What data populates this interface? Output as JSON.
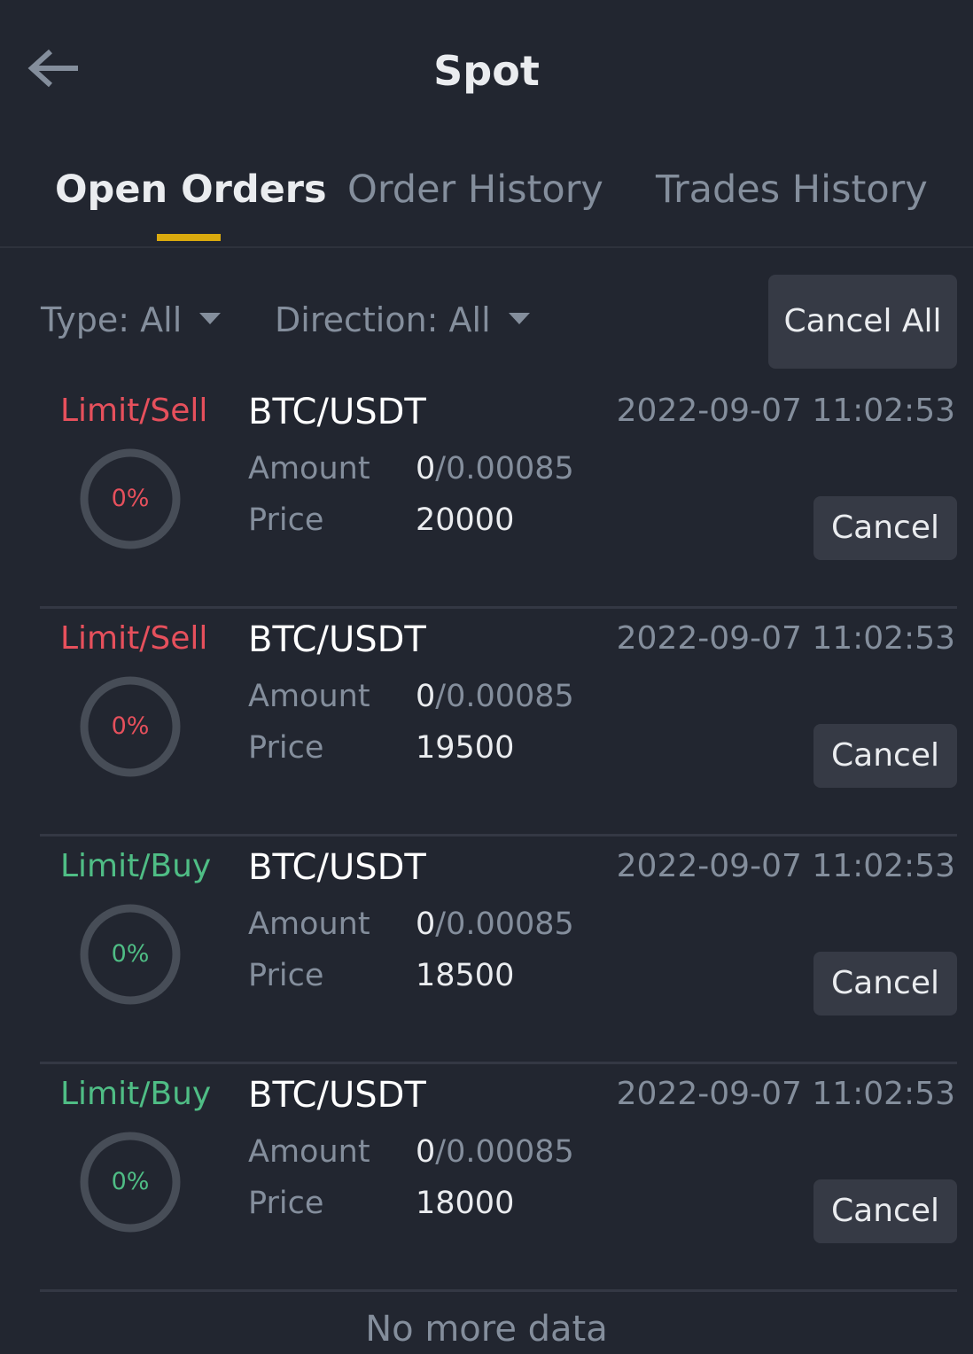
{
  "header": {
    "title": "Spot",
    "back_icon": "arrow-left-icon"
  },
  "tabs": [
    {
      "label": "Open Orders",
      "active": true
    },
    {
      "label": "Order History",
      "active": false
    },
    {
      "label": "Trades History",
      "active": false
    }
  ],
  "filters": {
    "type_label": "Type: All",
    "direction_label": "Direction: All",
    "caret_icon": "caret-down-icon",
    "cancel_all_label": "Cancel All"
  },
  "colors": {
    "background": "#222630",
    "accent": "#F0B90B",
    "sell": "#E6505C",
    "buy": "#4FBD85",
    "muted_text": "#848E9C",
    "button_bg": "#363A45"
  },
  "orders": [
    {
      "side": "Limit/Sell",
      "direction": "sell",
      "pair": "BTC/USDT",
      "time": "2022-09-07 11:02:53",
      "amount_label": "Amount",
      "amount_filled": "0",
      "amount_total": "/0.00085",
      "price_label": "Price",
      "price": "20000",
      "progress_label": "0%",
      "progress": 0,
      "cancel_label": "Cancel"
    },
    {
      "side": "Limit/Sell",
      "direction": "sell",
      "pair": "BTC/USDT",
      "time": "2022-09-07 11:02:53",
      "amount_label": "Amount",
      "amount_filled": "0",
      "amount_total": "/0.00085",
      "price_label": "Price",
      "price": "19500",
      "progress_label": "0%",
      "progress": 0,
      "cancel_label": "Cancel"
    },
    {
      "side": "Limit/Buy",
      "direction": "buy",
      "pair": "BTC/USDT",
      "time": "2022-09-07 11:02:53",
      "amount_label": "Amount",
      "amount_filled": "0",
      "amount_total": "/0.00085",
      "price_label": "Price",
      "price": "18500",
      "progress_label": "0%",
      "progress": 0,
      "cancel_label": "Cancel"
    },
    {
      "side": "Limit/Buy",
      "direction": "buy",
      "pair": "BTC/USDT",
      "time": "2022-09-07 11:02:53",
      "amount_label": "Amount",
      "amount_filled": "0",
      "amount_total": "/0.00085",
      "price_label": "Price",
      "price": "18000",
      "progress_label": "0%",
      "progress": 0,
      "cancel_label": "Cancel"
    }
  ],
  "footer": {
    "no_more_label": "No more data"
  }
}
